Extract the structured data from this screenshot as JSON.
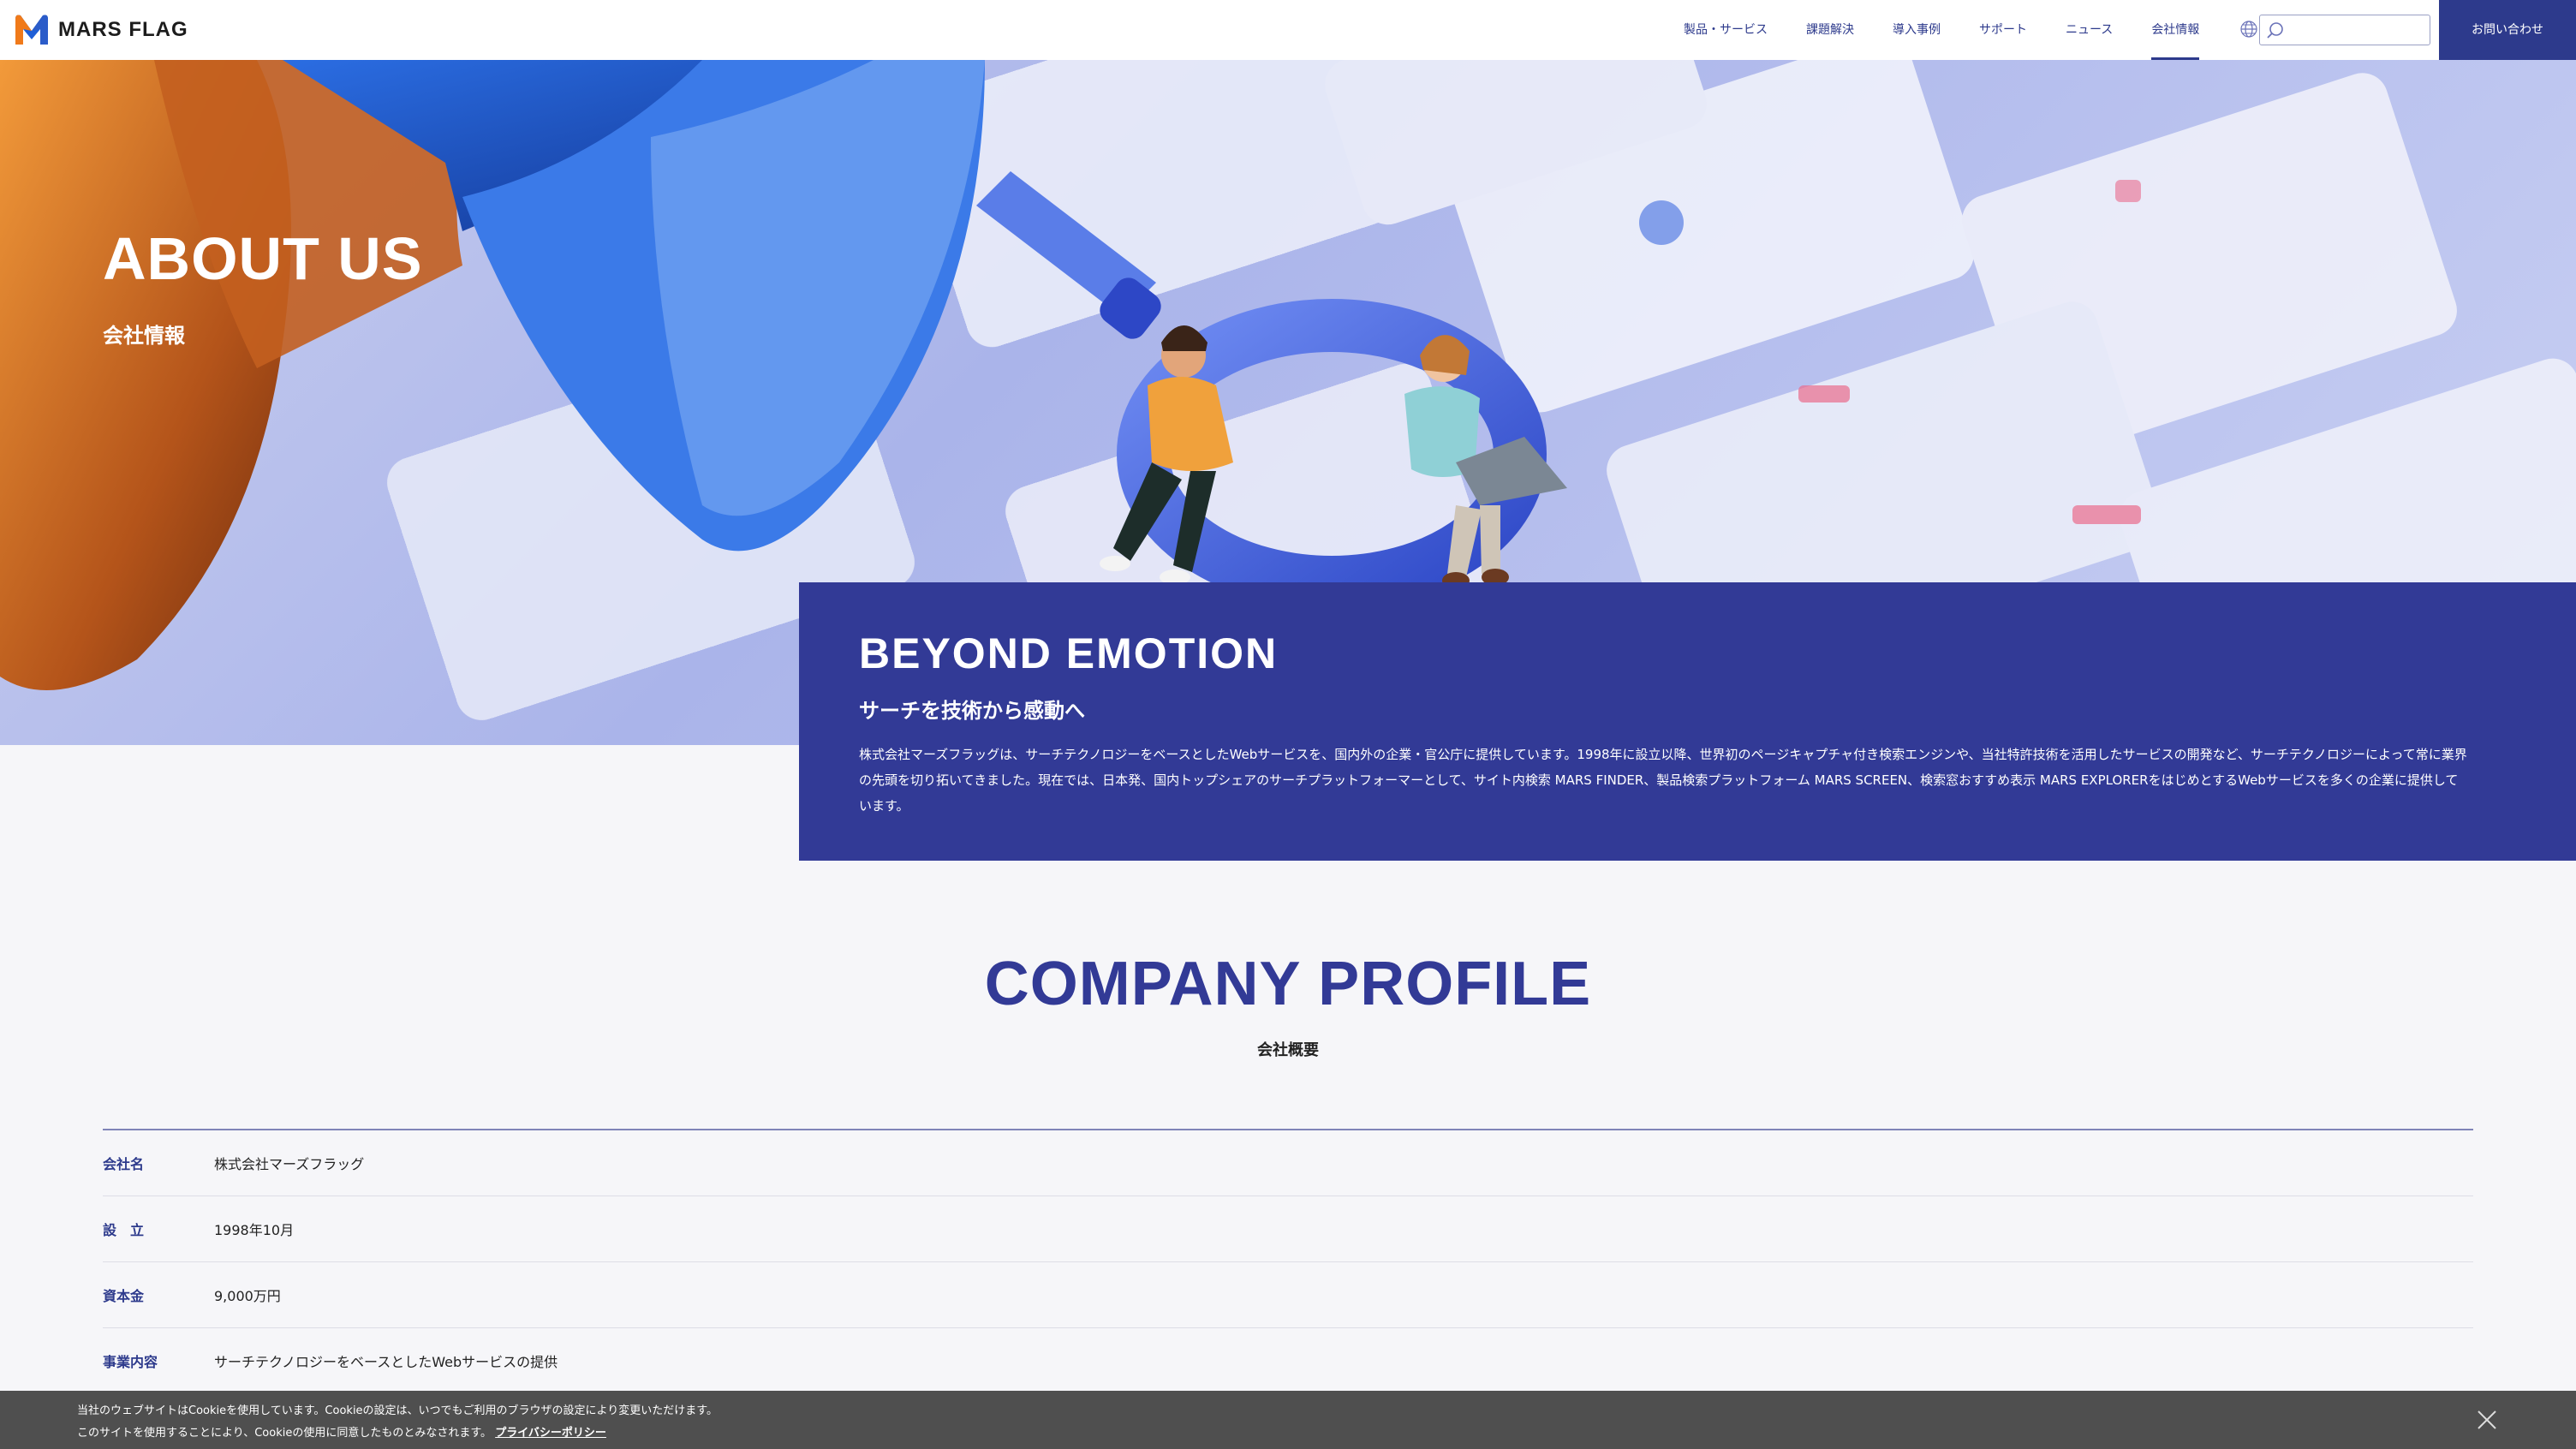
{
  "brand": {
    "name": "MARS FLAG"
  },
  "nav": {
    "items": [
      {
        "label": "製品・サービス",
        "active": false
      },
      {
        "label": "課題解決",
        "active": false
      },
      {
        "label": "導入事例",
        "active": false
      },
      {
        "label": "サポート",
        "active": false
      },
      {
        "label": "ニュース",
        "active": false
      },
      {
        "label": "会社情報",
        "active": true
      }
    ],
    "search_placeholder": "",
    "contact_label": "お問い合わせ"
  },
  "hero": {
    "title": "ABOUT US",
    "subtitle": "会社情報"
  },
  "emotion": {
    "title": "BEYOND EMOTION",
    "subtitle": "サーチを技術から感動へ",
    "body": "株式会社マーズフラッグは、サーチテクノロジーをベースとしたWebサービスを、国内外の企業・官公庁に提供しています。1998年に設立以降、世界初のページキャプチャ付き検索エンジンや、当社特許技術を活用したサービスの開発など、サーチテクノロジーによって常に業界の先頭を切り拓いてきました。現在では、日本発、国内トップシェアのサーチプラットフォーマーとして、サイト内検索 MARS FINDER、製品検索プラットフォーム MARS SCREEN、検索窓おすすめ表示 MARS EXPLORERをはじめとするWebサービスを多くの企業に提供しています。"
  },
  "profile": {
    "title": "COMPANY PROFILE",
    "subtitle": "会社概要",
    "rows": [
      {
        "label": "会社名",
        "value": "株式会社マーズフラッグ"
      },
      {
        "label": "設　立",
        "value": "1998年10月"
      },
      {
        "label": "資本金",
        "value": "9,000万円"
      },
      {
        "label": "事業内容",
        "value": "サーチテクノロジーをベースとしたWebサービスの提供"
      }
    ]
  },
  "cookie": {
    "line1": "当社のウェブサイトはCookieを使用しています。Cookieの設定は、いつでもご利用のブラウザの設定により変更いただけます。",
    "line2": "このサイトを使用することにより、Cookieの使用に同意したものとみなされます。",
    "link": "プライバシーポリシー"
  },
  "colors": {
    "brand_navy": "#2d3a8c",
    "emotion_bg": "#323a96",
    "cookie_bg": "#4f4f4f"
  },
  "icons": [
    "mars-flag-logo-icon",
    "globe-icon",
    "search-icon",
    "close-icon"
  ]
}
